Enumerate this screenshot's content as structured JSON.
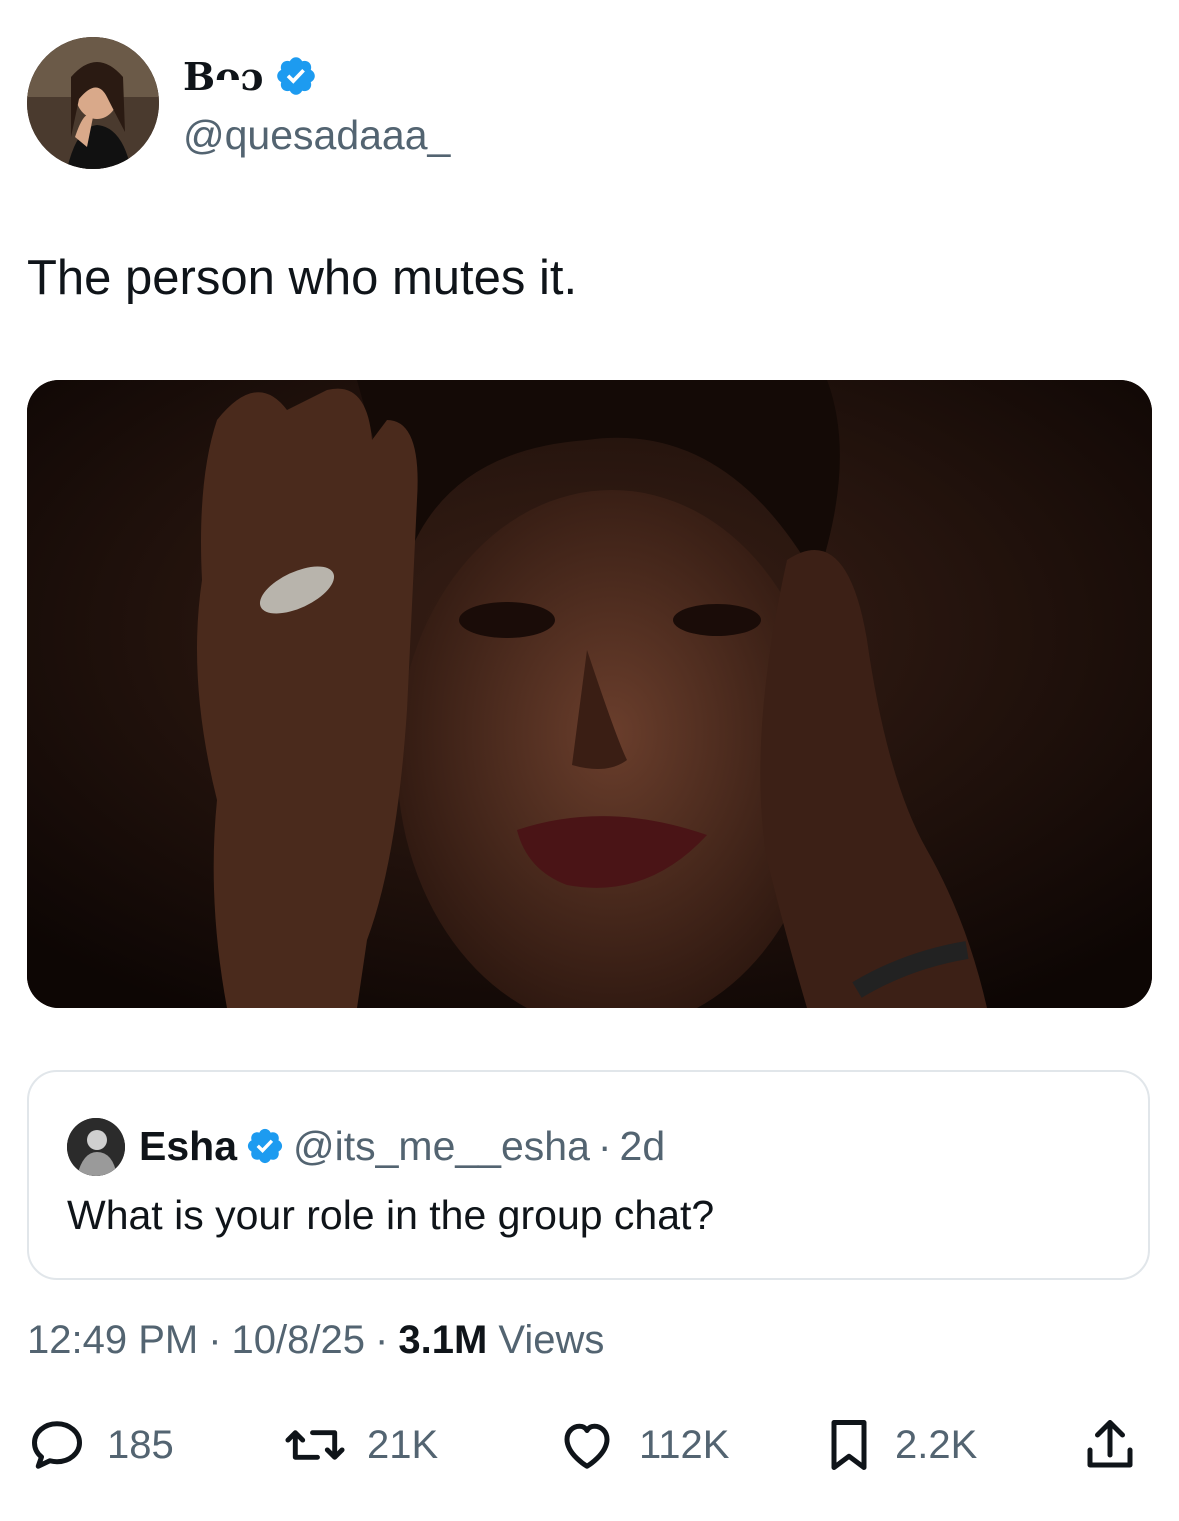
{
  "author": {
    "display_name": "Bᴖɔ",
    "handle": "@quesadaaa_",
    "verified": true
  },
  "tweet": {
    "text": "The person who mutes it.",
    "media_icon": "crying-woman-photo"
  },
  "quoted_tweet": {
    "name": "Esha",
    "handle": "@its_me__esha",
    "separator": "·",
    "age": "2d",
    "text": "What is your role in the group chat?"
  },
  "meta": {
    "time": "12:49 PM",
    "sep1": "·",
    "date": "10/8/25",
    "sep2": "·",
    "views_count": "3.1M",
    "views_label": "Views"
  },
  "actions": {
    "replies": "185",
    "reposts": "21K",
    "likes": "112K",
    "bookmarks": "2.2K"
  },
  "colors": {
    "verified_blue": "#1d9bf0",
    "text_primary": "#0f1419",
    "text_secondary": "#536471",
    "border": "#e1e6ea"
  }
}
